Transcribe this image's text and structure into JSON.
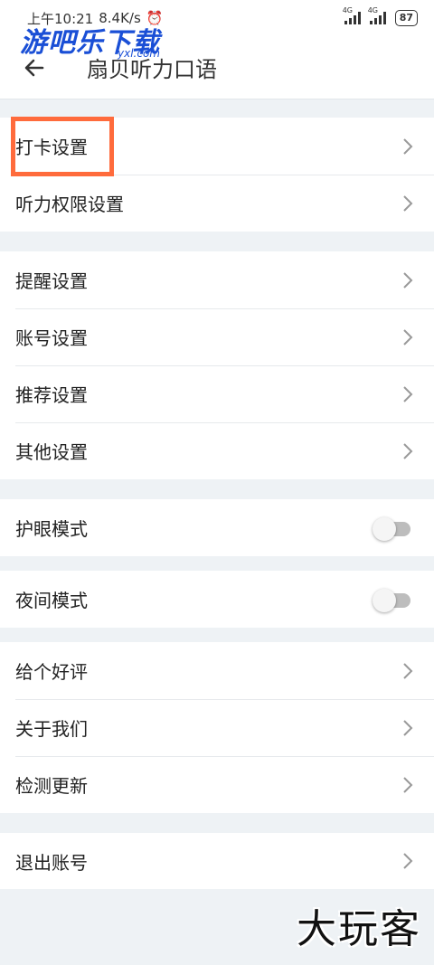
{
  "status_bar": {
    "time": "上午10:21",
    "speed": "8.4K/s",
    "net1": "4G",
    "net2": "4G",
    "battery": "87"
  },
  "watermark": {
    "text": "游吧乐下载",
    "sub": "yxl.com"
  },
  "header": {
    "title": "扇贝听力口语"
  },
  "groups": {
    "g1": [
      "打卡设置",
      "听力权限设置"
    ],
    "g2": [
      "提醒设置",
      "账号设置",
      "推荐设置",
      "其他设置"
    ],
    "g3": [
      "护眼模式"
    ],
    "g4": [
      "夜间模式"
    ],
    "g5": [
      "给个好评",
      "关于我们",
      "检测更新"
    ],
    "g6": [
      "退出账号"
    ]
  },
  "toggles": {
    "eye_protection": false,
    "night_mode": false
  },
  "corner_mark": "大玩客",
  "colors": {
    "highlight": "#ff6b3c",
    "background": "#eef2f5",
    "watermark": "#1a4fd6"
  }
}
